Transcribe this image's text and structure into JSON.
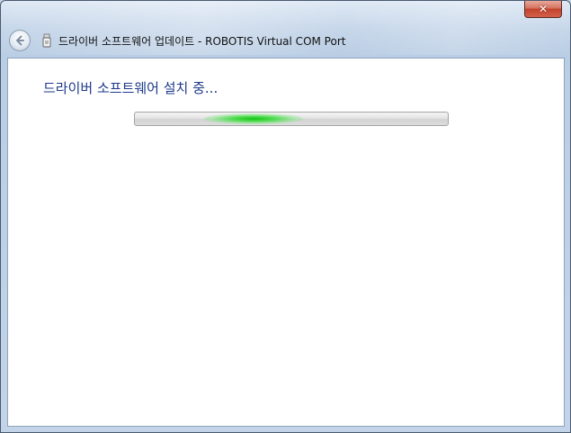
{
  "window": {
    "title": "드라이버 소프트웨어 업데이트 - ROBOTIS Virtual COM Port",
    "close_label": "✕"
  },
  "main": {
    "heading": "드라이버 소프트웨어 설치 중...",
    "progress": {
      "mode": "indeterminate",
      "glow_position": 0.38,
      "glow_color": "#16c416"
    }
  },
  "colors": {
    "heading_text": "#1e3a8a",
    "close_button": "#c2432b",
    "title_bar": "#c7d7ea"
  },
  "icons": {
    "back": "back-arrow-icon",
    "device": "usb-device-icon",
    "close": "close-icon"
  }
}
